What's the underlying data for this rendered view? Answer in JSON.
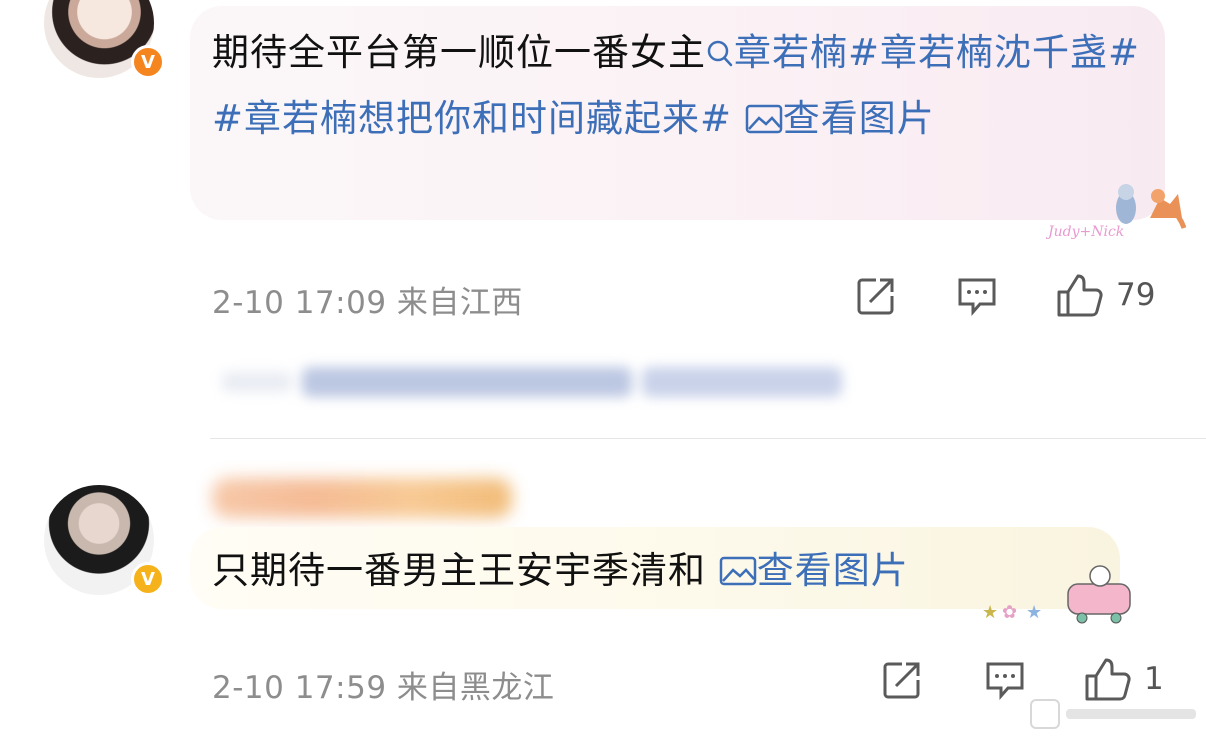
{
  "comments": [
    {
      "text_plain": "期待全平台第一顺位一番女主",
      "search_topic": "章若楠",
      "hashtag1": "#章若楠沈千盏#",
      "hashtag2": "#章若楠想把你和时间藏起来#",
      "view_image": "查看图片",
      "time": "2-10 17:09",
      "location": "来自江西",
      "likes": "79",
      "badge": "V"
    },
    {
      "text_plain": "只期待一番男主王安宇季清和",
      "view_image": "查看图片",
      "time": "2-10 17:59",
      "location": "来自黑龙江",
      "likes": "1",
      "badge": "V"
    }
  ],
  "colors": {
    "link": "#3d6fb8",
    "meta": "#8d8d8d",
    "badge_orange": "#f5861f",
    "badge_yellow": "#f6b21a"
  },
  "icons": [
    "search-icon",
    "image-icon",
    "share-icon",
    "comment-icon",
    "like-icon"
  ]
}
